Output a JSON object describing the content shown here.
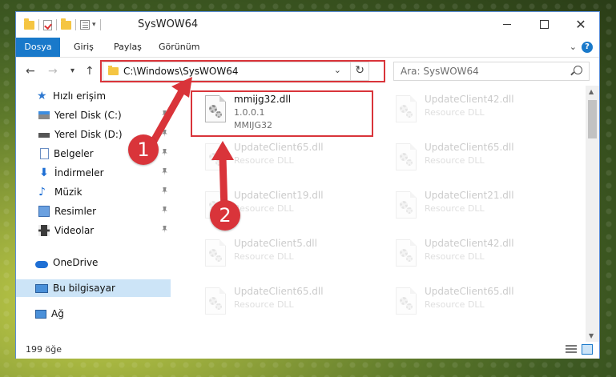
{
  "window": {
    "title": "SysWOW64",
    "minimize_icon": "minimize-icon",
    "maximize_icon": "maximize-icon",
    "close_glyph": "✕"
  },
  "ribbon": {
    "tabs": [
      "Dosya",
      "Giriş",
      "Paylaş",
      "Görünüm"
    ],
    "help_label": "?"
  },
  "navigation": {
    "back": "←",
    "forward": "→",
    "recent": "▾",
    "up": "↑",
    "address": "C:\\Windows\\SysWOW64",
    "refresh": "↻",
    "address_dropdown": "⌄",
    "search_placeholder": "Ara: SysWOW64"
  },
  "sidebar": {
    "items": [
      {
        "label": "Hızlı erişim",
        "icon": "star-icon"
      },
      {
        "label": "Yerel Disk (C:)",
        "icon": "drive-icon"
      },
      {
        "label": "Yerel Disk (D:)",
        "icon": "drive-icon"
      },
      {
        "label": "Belgeler",
        "icon": "documents-icon"
      },
      {
        "label": "İndirmeler",
        "icon": "downloads-icon"
      },
      {
        "label": "Müzik",
        "icon": "music-icon"
      },
      {
        "label": "Resimler",
        "icon": "pictures-icon"
      },
      {
        "label": "Videolar",
        "icon": "videos-icon"
      },
      {
        "label": "OneDrive",
        "icon": "onedrive-icon"
      },
      {
        "label": "Bu bilgisayar",
        "icon": "computer-icon"
      },
      {
        "label": "Ağ",
        "icon": "network-icon"
      }
    ],
    "glyphs": {
      "star": "★",
      "down": "⬇",
      "music": "♪"
    }
  },
  "files": [
    {
      "name": "mmijg32.dll",
      "line2": "1.0.0.1",
      "line3": "MMIJG32"
    },
    {
      "name": "UpdateClient42.dll",
      "line2": "Resource DLL"
    },
    {
      "name": "UpdateClient65.dll",
      "line2": "Resource DLL"
    },
    {
      "name": "UpdateClient65.dll",
      "line2": "Resource DLL"
    },
    {
      "name": "UpdateClient19.dll",
      "line2": "Resource DLL"
    },
    {
      "name": "UpdateClient21.dll",
      "line2": "Resource DLL"
    },
    {
      "name": "UpdateClient5.dll",
      "line2": "Resource DLL"
    },
    {
      "name": "UpdateClient42.dll",
      "line2": "Resource DLL"
    },
    {
      "name": "UpdateClient65.dll",
      "line2": "Resource DLL"
    },
    {
      "name": "UpdateClient65.dll",
      "line2": "Resource DLL"
    }
  ],
  "status": {
    "item_count": "199 öğe"
  },
  "callouts": [
    "1",
    "2"
  ],
  "colors": {
    "accent": "#1979ca",
    "highlight": "#d9343a",
    "selection": "#cce4f7"
  }
}
